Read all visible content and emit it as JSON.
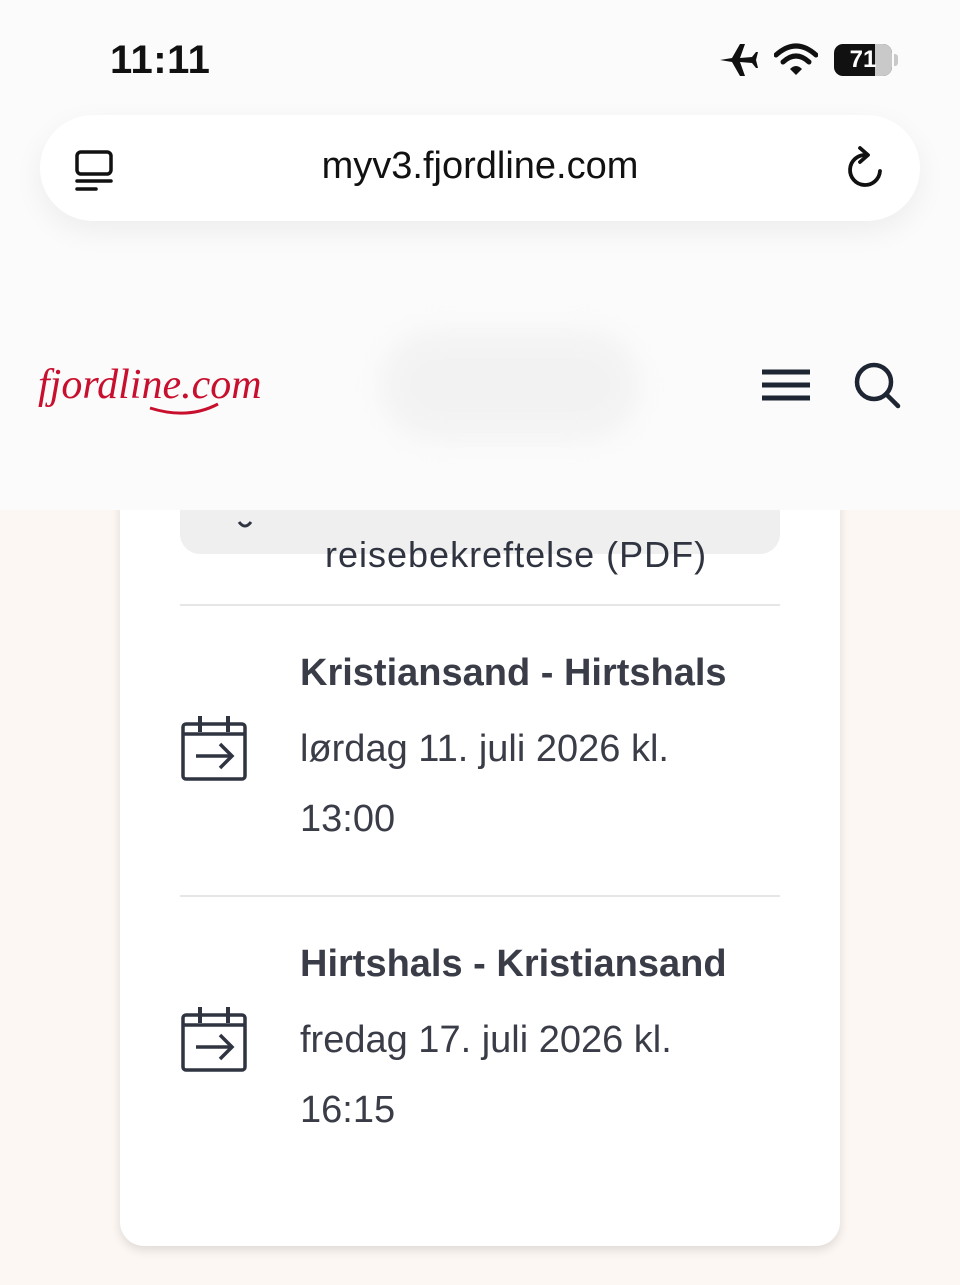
{
  "status_bar": {
    "time": "11:11",
    "battery": "71",
    "battery_level": 0.71
  },
  "browser": {
    "url": "myv3.fjordline.com"
  },
  "site": {
    "logo_text": "fjordline.com",
    "brand_color": "#c8102e"
  },
  "card": {
    "pdf_button_label": "reisebekreftelse (PDF)",
    "trips": [
      {
        "route": "Kristiansand - Hirtshals",
        "date_line1": "lørdag 11. juli 2026 kl.",
        "date_line2": "13:00"
      },
      {
        "route": "Hirtshals - Kristiansand",
        "date_line1": "fredag 17. juli 2026 kl.",
        "date_line2": "16:15"
      }
    ]
  }
}
